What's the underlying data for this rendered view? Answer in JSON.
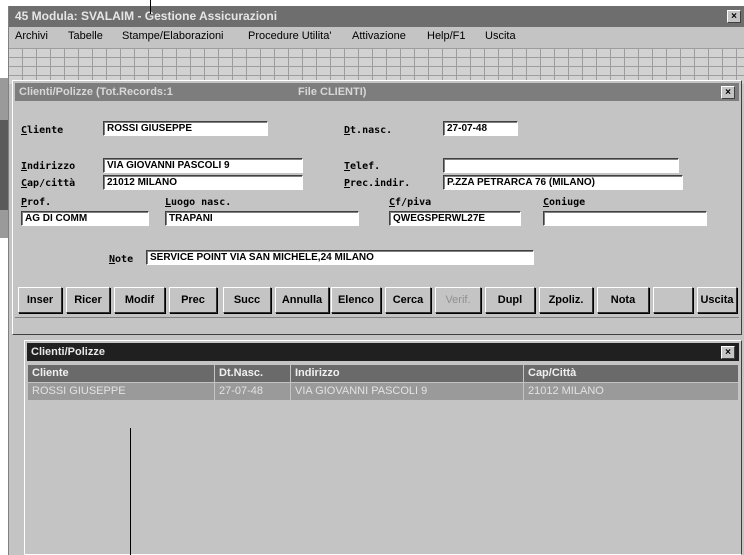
{
  "app": {
    "title": "45 Modula: SVALAIM - Gestione Assicurazioni",
    "close": "×"
  },
  "menu": [
    {
      "label": "Archivi"
    },
    {
      "label": "Tabelle"
    },
    {
      "label": "Stampe/Elaborazioni"
    },
    {
      "label": "Procedure Utilita'"
    },
    {
      "label": "Attivazione"
    },
    {
      "label": "Help/F1"
    },
    {
      "label": "Uscita"
    }
  ],
  "dialog": {
    "title": "Clienti/Polizze (Tot.Records:1",
    "file": "File CLIENTI)",
    "close": "×",
    "labels": {
      "cliente": "Cliente",
      "dt_nasc": "Dt.nasc.",
      "indirizzo": "Indirizzo",
      "telef": "Telef.",
      "cap_citta": "Cap/città",
      "prec_indir": "Prec.indir.",
      "prof": "Prof.",
      "luogo_nasc": "Luogo nasc.",
      "cf_piva": "Cf/piva",
      "coniuge": "Coniuge",
      "note": "Note"
    },
    "values": {
      "cliente": "ROSSI GIUSEPPE",
      "dt_nasc": "27-07-48",
      "indirizzo": "VIA GIOVANNI PASCOLI 9",
      "telef": "",
      "cap_citta": "21012 MILANO",
      "prec_indir": "P.ZZA PETRARCA 76   (MILANO)",
      "prof": "AG DI COMM",
      "luogo_nasc": "TRAPANI",
      "cf_piva": "QWEGSPERWL27E",
      "coniuge": "",
      "note": "SERVICE POINT VIA SAN MICHELE,24 MILANO"
    },
    "buttons": [
      {
        "label": "Inser"
      },
      {
        "label": "Ricer"
      },
      {
        "label": "Modif"
      },
      {
        "label": "Prec"
      },
      {
        "label": "Succ"
      },
      {
        "label": "Annulla"
      },
      {
        "label": "Elenco"
      },
      {
        "label": "Cerca"
      },
      {
        "label": "Verif."
      },
      {
        "label": "Dupl"
      },
      {
        "label": "Zpoliz."
      },
      {
        "label": "Nota"
      },
      {
        "label": ""
      },
      {
        "label": "Uscita"
      }
    ]
  },
  "list": {
    "title": "Clienti/Polizze",
    "close": "×",
    "columns": [
      "Cliente",
      "Dt.Nasc.",
      "Indirizzo",
      "Cap/Città"
    ],
    "rows": [
      [
        "ROSSI GIUSEPPE",
        "27-07-48",
        "VIA GIOVANNI PASCOLI 9",
        "21012 MILANO"
      ]
    ]
  }
}
